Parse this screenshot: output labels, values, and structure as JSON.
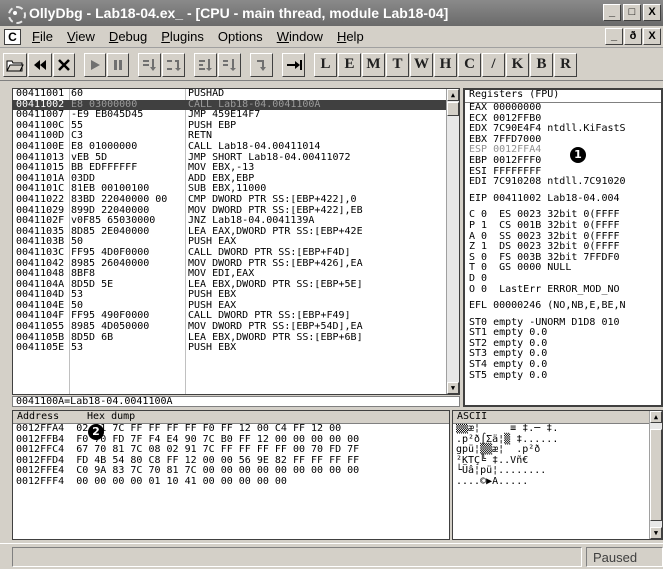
{
  "window": {
    "title": "OllyDbg - Lab18-04.ex_ - [CPU - main thread, module Lab18-04]",
    "controls": [
      "_",
      "□",
      "X"
    ],
    "mdi_controls": [
      "_",
      "ð",
      "X"
    ]
  },
  "menu": {
    "child_icon": "C",
    "items": [
      {
        "accel": "F",
        "rest": "ile"
      },
      {
        "accel": "V",
        "rest": "iew"
      },
      {
        "accel": "D",
        "rest": "ebug"
      },
      {
        "accel": "P",
        "rest": "lugins"
      },
      {
        "accel": "",
        "rest": "Options"
      },
      {
        "accel": "W",
        "rest": "indow"
      },
      {
        "accel": "H",
        "rest": "elp"
      }
    ]
  },
  "toolbar": {
    "buttons": [
      "open-icon",
      "restart-icon",
      "close-icon",
      "run-icon",
      "pause-icon",
      "step-into-icon",
      "step-over-icon",
      "trace-into-icon",
      "trace-over-icon",
      "execute-till-return-icon",
      "goto-icon"
    ],
    "letters": [
      "L",
      "E",
      "M",
      "T",
      "W",
      "H",
      "C",
      "/",
      "K",
      "B",
      "R"
    ]
  },
  "disasm": {
    "rows": [
      {
        "addr": "00411001",
        "hex": "60",
        "ins": "PUSHAD"
      },
      {
        "addr": "00411002",
        "hex": "E8 03000000",
        "ins": "CALL Lab18-04.0041100A",
        "selected": true
      },
      {
        "addr": "00411007",
        "hex": "-E9 EB045D45",
        "ins": "JMP 459E14F7"
      },
      {
        "addr": "0041100C",
        "hex": "55",
        "ins": "PUSH EBP"
      },
      {
        "addr": "0041100D",
        "hex": "C3",
        "ins": "RETN"
      },
      {
        "addr": "0041100E",
        "hex": "E8 01000000",
        "ins": "CALL Lab18-04.00411014"
      },
      {
        "addr": "00411013",
        "hex": "vEB 5D",
        "ins": "JMP SHORT Lab18-04.00411072"
      },
      {
        "addr": "00411015",
        "hex": "BB EDFFFFFF",
        "ins": "MOV EBX,-13"
      },
      {
        "addr": "0041101A",
        "hex": "03DD",
        "ins": "ADD EBX,EBP"
      },
      {
        "addr": "0041101C",
        "hex": "81EB 00100100",
        "ins": "SUB EBX,11000"
      },
      {
        "addr": "00411022",
        "hex": "83BD 22040000 00",
        "ins": "CMP DWORD PTR SS:[EBP+422],0"
      },
      {
        "addr": "00411029",
        "hex": "899D 22040000",
        "ins": "MOV DWORD PTR SS:[EBP+422],EB"
      },
      {
        "addr": "0041102F",
        "hex": "v0F85 65030000",
        "ins": "JNZ Lab18-04.0041139A"
      },
      {
        "addr": "00411035",
        "hex": "8D85 2E040000",
        "ins": "LEA EAX,DWORD PTR SS:[EBP+42E"
      },
      {
        "addr": "0041103B",
        "hex": "50",
        "ins": "PUSH EAX"
      },
      {
        "addr": "0041103C",
        "hex": "FF95 4D0F0000",
        "ins": "CALL DWORD PTR SS:[EBP+F4D]"
      },
      {
        "addr": "00411042",
        "hex": "8985 26040000",
        "ins": "MOV DWORD PTR SS:[EBP+426],EA"
      },
      {
        "addr": "00411048",
        "hex": "8BF8",
        "ins": "MOV EDI,EAX"
      },
      {
        "addr": "0041104A",
        "hex": "8D5D 5E",
        "ins": "LEA EBX,DWORD PTR SS:[EBP+5E]"
      },
      {
        "addr": "0041104D",
        "hex": "53",
        "ins": "PUSH EBX"
      },
      {
        "addr": "0041104E",
        "hex": "50",
        "ins": "PUSH EAX"
      },
      {
        "addr": "0041104F",
        "hex": "FF95 490F0000",
        "ins": "CALL DWORD PTR SS:[EBP+F49]"
      },
      {
        "addr": "00411055",
        "hex": "8985 4D050000",
        "ins": "MOV DWORD PTR SS:[EBP+54D],EA"
      },
      {
        "addr": "0041105B",
        "hex": "8D5D 6B",
        "ins": "LEA EBX,DWORD PTR SS:[EBP+6B]"
      },
      {
        "addr": "0041105E",
        "hex": "53",
        "ins": "PUSH EBX"
      }
    ],
    "info": "0041100A=Lab18-04.0041100A"
  },
  "registers": {
    "header": "Registers (FPU)",
    "rows": [
      {
        "text": "EAX 00000000"
      },
      {
        "text": "ECX 0012FFB0"
      },
      {
        "text": "EDX 7C90E4F4 ntdll.KiFastS"
      },
      {
        "text": "EBX 7FFD7000"
      },
      {
        "text": "ESP 0012FFA4",
        "highlight": true
      },
      {
        "text": "EBP 0012FFF0"
      },
      {
        "text": "ESI FFFFFFFF"
      },
      {
        "text": "EDI 7C910208 ntdll.7C91020"
      },
      {
        "gap": true
      },
      {
        "text": "EIP 00411002 Lab18-04.004"
      },
      {
        "gap": true
      },
      {
        "text": "C 0  ES 0023 32bit 0(FFFF"
      },
      {
        "text": "P 1  CS 001B 32bit 0(FFFF"
      },
      {
        "text": "A 0  SS 0023 32bit 0(FFFF"
      },
      {
        "text": "Z 1  DS 0023 32bit 0(FFFF"
      },
      {
        "text": "S 0  FS 003B 32bit 7FFDF0"
      },
      {
        "text": "T 0  GS 0000 NULL"
      },
      {
        "text": "D 0"
      },
      {
        "text": "O 0  LastErr ERROR_MOD_NO"
      },
      {
        "gap": true
      },
      {
        "text": "EFL 00000246 (NO,NB,E,BE,N"
      },
      {
        "gap": true
      },
      {
        "text": "ST0 empty -UNORM D1D8 010"
      },
      {
        "text": "ST1 empty 0.0"
      },
      {
        "text": "ST2 empty 0.0"
      },
      {
        "text": "ST3 empty 0.0"
      },
      {
        "text": "ST4 empty 0.0"
      },
      {
        "text": "ST5 empty 0.0"
      }
    ]
  },
  "dump": {
    "headers": {
      "address": "Address",
      "hex": "Hex dump",
      "ascii": "ASCII"
    },
    "rows": [
      {
        "addr": "0012FFA4",
        "hex": "02 91 7C FF FF FF FF F0 FF 12 00 C4 FF 12 00"
      },
      {
        "addr": "0012FFB4",
        "hex": "F0 70 FD 7F F4 E4 90 7C B0 FF 12 00 00 00 00 00"
      },
      {
        "addr": "0012FFC4",
        "hex": "67 70 81 7C 08 02 91 7C FF FF FF FF 00 70 FD 7F"
      },
      {
        "addr": "0012FFD4",
        "hex": "FD 4B 54 80 C8 FF 12 00 00 56 9E 82 FF FF FF FF"
      },
      {
        "addr": "0012FFE4",
        "hex": "C0 9A 83 7C 70 81 7C 00 00 00 00 00 00 00 00 00"
      },
      {
        "addr": "0012FFF4",
        "hex": "00 00 00 00 01 10 41 00 00 00 00 00"
      }
    ],
    "ascii_rows": [
      "▒▒æ¦     ≡ ‡.─ ‡.",
      ".p²ð⌠Σä¦▒ ‡......",
      "gpü¦▒▒æ¦  .p²ð",
      "²KTÇ╚ ‡..Vñ€",
      "└Üâ¦pü¦........",
      "....©▶A....."
    ]
  },
  "annotations": {
    "one": "1",
    "two": "2"
  },
  "status": {
    "message": "",
    "state": "Paused"
  }
}
